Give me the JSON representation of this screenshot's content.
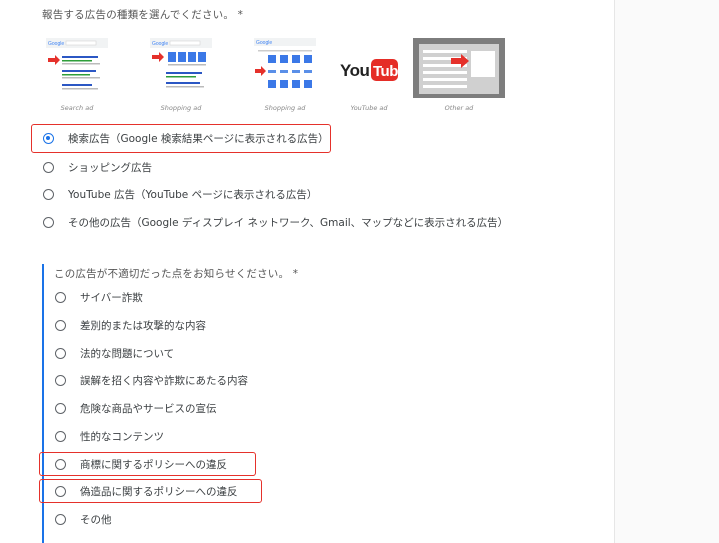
{
  "q1": {
    "title": "報告する広告の種類を選んでください。 *",
    "thumbnails": [
      {
        "caption": "Search ad",
        "logo": "Google"
      },
      {
        "caption": "Shopping ad",
        "logo": "Google"
      },
      {
        "caption": "Shopping ad",
        "logo": "Google"
      },
      {
        "caption": "YouTube ad",
        "logo": "YouTube"
      },
      {
        "caption": "Other ad"
      }
    ],
    "options": [
      {
        "label": "検索広告（Google 検索結果ページに表示される広告）",
        "checked": true
      },
      {
        "label": "ショッピング広告",
        "checked": false
      },
      {
        "label": "YouTube 広告（YouTube ページに表示される広告）",
        "checked": false
      },
      {
        "label": "その他の広告（Google ディスプレイ ネットワーク、Gmail、マップなどに表示される広告）",
        "checked": false
      }
    ]
  },
  "q2": {
    "title": "この広告が不適切だった点をお知らせください。 *",
    "options": [
      {
        "label": "サイバー詐欺"
      },
      {
        "label": "差別的または攻撃的な内容"
      },
      {
        "label": "法的な問題について"
      },
      {
        "label": "誤解を招く内容や詐欺にあたる内容"
      },
      {
        "label": "危険な商品やサービスの宣伝"
      },
      {
        "label": "性的なコンテンツ"
      },
      {
        "label": "商標に関するポリシーへの違反"
      },
      {
        "label": "偽造品に関するポリシーへの違反"
      },
      {
        "label": "その他"
      }
    ]
  },
  "colors": {
    "accent": "#1a73e8",
    "highlight": "#e5312b",
    "youtube": "#e52d27"
  }
}
